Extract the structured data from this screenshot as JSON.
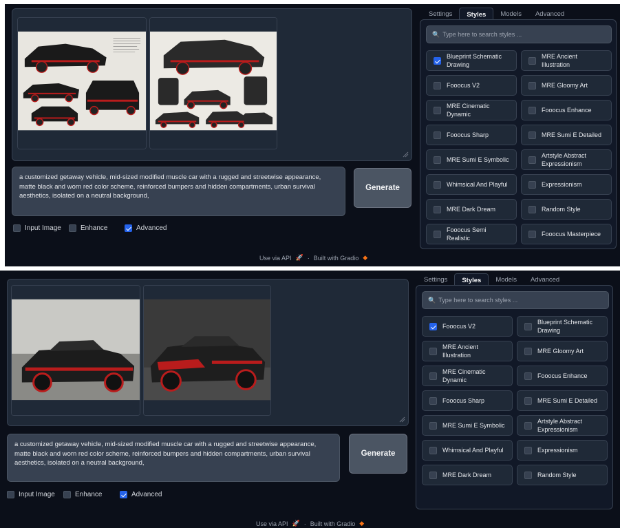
{
  "prompt_text": "a customized getaway vehicle, mid-sized modified muscle car with a rugged and streetwise appearance, matte black and worn red color scheme, reinforced bumpers and hidden compartments, urban survival aesthetics, isolated on a neutral background,",
  "generate_label": "Generate",
  "options": {
    "input_image": "Input Image",
    "enhance": "Enhance",
    "advanced": "Advanced"
  },
  "footer": {
    "api": "Use via API",
    "sep": "·",
    "built": "Built with Gradio"
  },
  "tabs": [
    "Settings",
    "Styles",
    "Models",
    "Advanced"
  ],
  "search_placeholder": "Type here to search styles ...",
  "panel1_styles": [
    {
      "label": "Blueprint Schematic Drawing",
      "checked": true
    },
    {
      "label": "MRE Ancient Illustration",
      "checked": false
    },
    {
      "label": "Fooocus V2",
      "checked": false
    },
    {
      "label": "MRE Gloomy Art",
      "checked": false
    },
    {
      "label": "MRE Cinematic Dynamic",
      "checked": false
    },
    {
      "label": "Fooocus Enhance",
      "checked": false
    },
    {
      "label": "Fooocus Sharp",
      "checked": false
    },
    {
      "label": "MRE Sumi E Detailed",
      "checked": false
    },
    {
      "label": "MRE Sumi E Symbolic",
      "checked": false
    },
    {
      "label": "Artstyle Abstract Expressionism",
      "checked": false
    },
    {
      "label": "Whimsical And Playful",
      "checked": false
    },
    {
      "label": "Expressionism",
      "checked": false
    },
    {
      "label": "MRE Dark Dream",
      "checked": false
    },
    {
      "label": "Random Style",
      "checked": false
    },
    {
      "label": "Fooocus Semi Realistic",
      "checked": false
    },
    {
      "label": "Fooocus Masterpiece",
      "checked": false
    }
  ],
  "panel2_styles": [
    {
      "label": "Fooocus V2",
      "checked": true
    },
    {
      "label": "Blueprint Schematic Drawing",
      "checked": false
    },
    {
      "label": "MRE Ancient Illustration",
      "checked": false
    },
    {
      "label": "MRE Gloomy Art",
      "checked": false
    },
    {
      "label": "MRE Cinematic Dynamic",
      "checked": false
    },
    {
      "label": "Fooocus Enhance",
      "checked": false
    },
    {
      "label": "Fooocus Sharp",
      "checked": false
    },
    {
      "label": "MRE Sumi E Detailed",
      "checked": false
    },
    {
      "label": "MRE Sumi E Symbolic",
      "checked": false
    },
    {
      "label": "Artstyle Abstract Expressionism",
      "checked": false
    },
    {
      "label": "Whimsical And Playful",
      "checked": false
    },
    {
      "label": "Expressionism",
      "checked": false
    },
    {
      "label": "MRE Dark Dream",
      "checked": false
    },
    {
      "label": "Random Style",
      "checked": false
    }
  ],
  "colors": {
    "accent": "#2563eb",
    "background": "#0b0f19",
    "car_red": "#b91c1c"
  }
}
